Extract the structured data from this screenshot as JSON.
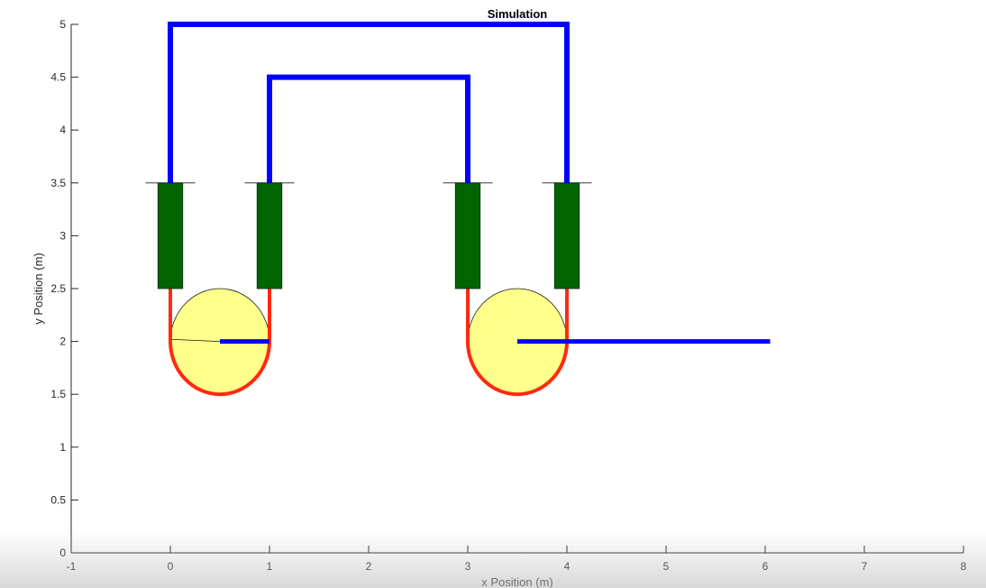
{
  "title": "Simulation",
  "xlabel": "x Position (m)",
  "ylabel": "y Position (m)",
  "xlim": [
    -1,
    8
  ],
  "ylim": [
    0,
    5
  ],
  "xticks": [
    -1,
    0,
    1,
    2,
    3,
    4,
    5,
    6,
    7,
    8
  ],
  "yticks": [
    0,
    0.5,
    1,
    1.5,
    2,
    2.5,
    3,
    3.5,
    4,
    4.5,
    5
  ],
  "grid": false,
  "colors": {
    "cable": "#0000ff",
    "belt": "#ff2a10",
    "belt_dark": "#c81e10",
    "block": "#006400",
    "pulley_fill": "#ffff8c",
    "axis": "#262626"
  },
  "diagram": {
    "top_cable": [
      [
        0,
        3.5
      ],
      [
        0,
        5
      ],
      [
        4,
        5
      ],
      [
        4,
        3.5
      ]
    ],
    "inner_cable": [
      [
        1,
        3.5
      ],
      [
        1,
        4.5
      ],
      [
        3,
        4.5
      ],
      [
        3,
        3.5
      ]
    ],
    "blocks": [
      {
        "x": 0,
        "y_bottom": 2.5,
        "y_top": 3.5,
        "width": 0.25
      },
      {
        "x": 1,
        "y_bottom": 2.5,
        "y_top": 3.5,
        "width": 0.25
      },
      {
        "x": 3,
        "y_bottom": 2.5,
        "y_top": 3.5,
        "width": 0.25
      },
      {
        "x": 4,
        "y_bottom": 2.5,
        "y_top": 3.5,
        "width": 0.25
      }
    ],
    "block_caps": [
      {
        "x1": -0.25,
        "x2": 0.25,
        "y": 3.5
      },
      {
        "x1": 0.75,
        "x2": 1.25,
        "y": 3.5
      },
      {
        "x1": 2.75,
        "x2": 3.25,
        "y": 3.5
      },
      {
        "x1": 3.75,
        "x2": 4.25,
        "y": 3.5
      }
    ],
    "pulleys": [
      {
        "cx": 0.5,
        "cy": 2,
        "r": 0.5,
        "radius_line_end": [
          0,
          2.02
        ]
      },
      {
        "cx": 3.5,
        "cy": 2,
        "r": 0.5,
        "radius_line_end": null
      }
    ],
    "belts": [
      {
        "left_x": 0,
        "right_x": 1,
        "top_y": 2.5,
        "center_y": 2
      },
      {
        "left_x": 3,
        "right_x": 4,
        "top_y": 2.5,
        "center_y": 2
      }
    ],
    "arms": [
      {
        "x1": 0.5,
        "x2": 1,
        "y": 2
      },
      {
        "x1": 3.5,
        "x2": 6.05,
        "y": 2
      }
    ]
  }
}
